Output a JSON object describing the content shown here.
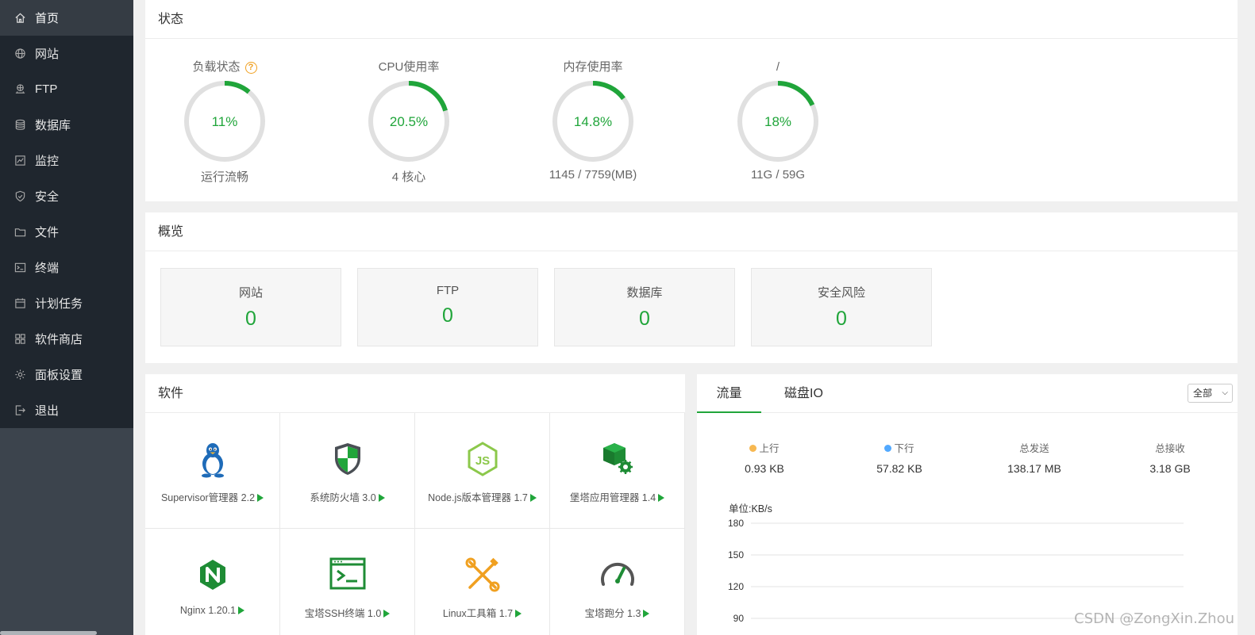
{
  "sidebar": {
    "items": [
      {
        "label": "首页",
        "icon": "home-icon",
        "active": true
      },
      {
        "label": "网站",
        "icon": "globe-icon",
        "active": false
      },
      {
        "label": "FTP",
        "icon": "ftp-icon",
        "active": false
      },
      {
        "label": "数据库",
        "icon": "database-icon",
        "active": false
      },
      {
        "label": "监控",
        "icon": "monitor-icon",
        "active": false
      },
      {
        "label": "安全",
        "icon": "shield-icon",
        "active": false
      },
      {
        "label": "文件",
        "icon": "folder-icon",
        "active": false
      },
      {
        "label": "终端",
        "icon": "terminal-icon",
        "active": false
      },
      {
        "label": "计划任务",
        "icon": "calendar-icon",
        "active": false
      },
      {
        "label": "软件商店",
        "icon": "grid-icon",
        "active": false
      },
      {
        "label": "面板设置",
        "icon": "gear-icon",
        "active": false
      },
      {
        "label": "退出",
        "icon": "logout-icon",
        "active": false
      }
    ]
  },
  "status": {
    "title": "状态",
    "gauges": [
      {
        "label": "负载状态",
        "value_text": "11%",
        "percent": 11,
        "sub": "运行流畅",
        "help": "?"
      },
      {
        "label": "CPU使用率",
        "value_text": "20.5%",
        "percent": 20.5,
        "sub": "4 核心"
      },
      {
        "label": "内存使用率",
        "value_text": "14.8%",
        "percent": 14.8,
        "sub": "1145 / 7759(MB)"
      },
      {
        "label": "/",
        "value_text": "18%",
        "percent": 18,
        "sub": "11G / 59G"
      }
    ]
  },
  "overview": {
    "title": "概览",
    "cards": [
      {
        "label": "网站",
        "value": "0"
      },
      {
        "label": "FTP",
        "value": "0"
      },
      {
        "label": "数据库",
        "value": "0"
      },
      {
        "label": "安全风险",
        "value": "0"
      }
    ]
  },
  "software": {
    "title": "软件",
    "items": [
      {
        "name": "Supervisor管理器 2.2",
        "icon": "linux-penguin-icon"
      },
      {
        "name": "系统防火墙 3.0",
        "icon": "firewall-shield-icon"
      },
      {
        "name": "Node.js版本管理器 1.7",
        "icon": "nodejs-icon"
      },
      {
        "name": "堡塔应用管理器 1.4",
        "icon": "app-box-gear-icon"
      },
      {
        "name": "Nginx 1.20.1",
        "icon": "nginx-icon"
      },
      {
        "name": "宝塔SSH终端 1.0",
        "icon": "ssh-terminal-icon"
      },
      {
        "name": "Linux工具箱 1.7",
        "icon": "toolbox-icon"
      },
      {
        "name": "宝塔跑分 1.3",
        "icon": "speedometer-icon"
      }
    ]
  },
  "traffic": {
    "tabs": [
      "流量",
      "磁盘IO"
    ],
    "active_tab": 0,
    "select_value": "全部",
    "stats": [
      {
        "label": "上行",
        "value": "0.93 KB",
        "dot_color": "#f7b851"
      },
      {
        "label": "下行",
        "value": "57.82 KB",
        "dot_color": "#52a9ff"
      },
      {
        "label": "总发送",
        "value": "138.17 MB"
      },
      {
        "label": "总接收",
        "value": "3.18 GB"
      }
    ],
    "unit": "单位:KB/s",
    "y_ticks": [
      "180",
      "150",
      "120",
      "90"
    ]
  },
  "colors": {
    "accent": "#20a53a",
    "sidebar_bg": "#3c444d",
    "sidebar_menu_bg": "#1f262e",
    "gauge_track": "#e0e0e0"
  },
  "watermark": "CSDN @ZongXin.Zhou"
}
